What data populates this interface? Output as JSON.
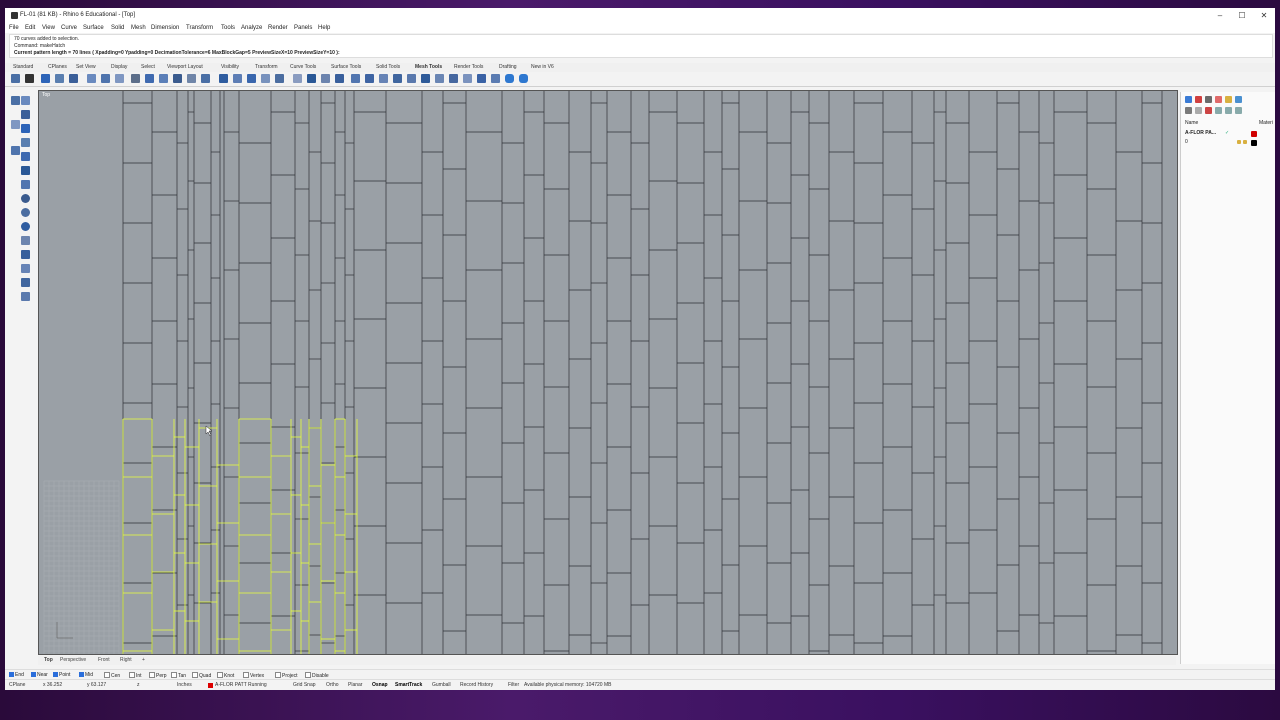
{
  "window": {
    "title": "FL-01 (81 KB) - Rhino 6 Educational - [Top]",
    "controls": [
      "–",
      "☐",
      "✕"
    ]
  },
  "menu": [
    "File",
    "Edit",
    "View",
    "Curve",
    "Surface",
    "Solid",
    "Mesh",
    "Dimension",
    "Transform",
    "Tools",
    "Analyze",
    "Render",
    "Panels",
    "Help"
  ],
  "command_history": [
    "70 curves added to selection.",
    "Command: makeHatch",
    "Current pattern length = 70 lines ( Xpadding=0  Ypadding=0  DecimationTolerance=6  MaxBlockGap=5  PreviewSizeX=10  PreviewSizeY=10 ):"
  ],
  "toolbar_tabs": [
    "Standard",
    "CPlanes",
    "Set View",
    "Display",
    "Select",
    "Viewport Layout",
    "Visibility",
    "Transform",
    "Curve Tools",
    "Surface Tools",
    "Solid Tools",
    "Mesh Tools",
    "Render Tools",
    "Drafting",
    "New in V6"
  ],
  "viewport": {
    "label": "Top",
    "background": "#9aa0a6",
    "grid_color": "#2d3035",
    "selected_color": "#e8ff3a"
  },
  "panel": {
    "header_name": "Name",
    "header_material": "Materi",
    "layer_name": "A-FLOR PA...",
    "layer_default": "0",
    "layer_color": "#d00000"
  },
  "viewport_tabs": [
    "Top",
    "Perspective",
    "Front",
    "Right",
    "+"
  ],
  "osnaps": [
    {
      "label": "End",
      "on": true
    },
    {
      "label": "Near",
      "on": true
    },
    {
      "label": "Point",
      "on": true
    },
    {
      "label": "Mid",
      "on": true
    },
    {
      "label": "Cen",
      "on": false
    },
    {
      "label": "Int",
      "on": false
    },
    {
      "label": "Perp",
      "on": false
    },
    {
      "label": "Tan",
      "on": false
    },
    {
      "label": "Quad",
      "on": false
    },
    {
      "label": "Knot",
      "on": false
    },
    {
      "label": "Vertex",
      "on": false
    },
    {
      "label": "Project",
      "on": false
    },
    {
      "label": "Disable",
      "on": false
    }
  ],
  "status": {
    "cplane": "CPlane",
    "x": "x 36.252",
    "y": "y 63.127",
    "z": "z",
    "units": "Inches",
    "layer": "A-FLOR PATT Running",
    "grid_snap": "Grid Snap",
    "ortho": "Ortho",
    "planar": "Planar",
    "osnap": "Osnap",
    "smarttrack": "SmartTrack",
    "gumball": "Gumball",
    "record_history": "Record History",
    "filter": "Filter",
    "memory": "Available physical memory: 104720 MB"
  }
}
